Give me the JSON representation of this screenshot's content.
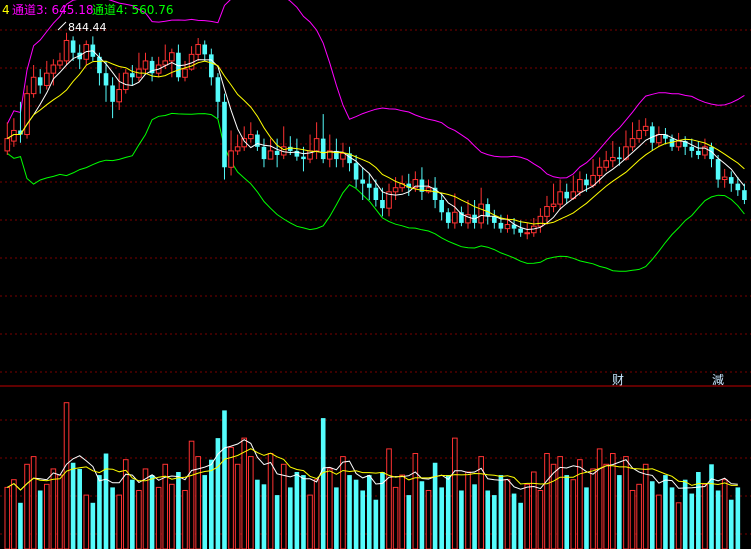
{
  "header": {
    "prefix": "4",
    "channel3_label": "通道3: 645.18",
    "channel4_label": "通道4: 560.76"
  },
  "annotations": {
    "high_label": "844.44",
    "marker_cai": "财",
    "marker_jian": "減"
  },
  "colors": {
    "up": "#ff3232",
    "down": "#54fcfc",
    "ma_white": "#ffffff",
    "ma_yellow": "#ffff00",
    "upper_band": "#ff00ff",
    "lower_band": "#00ff00",
    "grid": "#7a0000",
    "divider": "#c00000",
    "channel3_text": "#ff00ff",
    "channel4_text": "#00ff00",
    "marker_text": "#c8e8ff"
  },
  "chart_data": {
    "type": "candlestick+volume",
    "price_range": [
      420,
      860
    ],
    "volume_range": [
      0,
      100
    ],
    "candles": [
      [
        700,
        715,
        735,
        695
      ],
      [
        712,
        725,
        740,
        705
      ],
      [
        725,
        720,
        760,
        710
      ],
      [
        720,
        770,
        780,
        715
      ],
      [
        770,
        790,
        805,
        765
      ],
      [
        790,
        780,
        800,
        770
      ],
      [
        780,
        795,
        810,
        775
      ],
      [
        795,
        805,
        812,
        780
      ],
      [
        805,
        810,
        820,
        800
      ],
      [
        810,
        835,
        844.44,
        805
      ],
      [
        835,
        820,
        840,
        810
      ],
      [
        820,
        812,
        830,
        800
      ],
      [
        812,
        830,
        835,
        805
      ],
      [
        830,
        815,
        840,
        810
      ],
      [
        815,
        795,
        820,
        780
      ],
      [
        795,
        780,
        810,
        760
      ],
      [
        780,
        760,
        790,
        740
      ],
      [
        760,
        775,
        795,
        750
      ],
      [
        775,
        795,
        800,
        770
      ],
      [
        795,
        790,
        805,
        780
      ],
      [
        790,
        800,
        820,
        785
      ],
      [
        800,
        810,
        820,
        795
      ],
      [
        810,
        795,
        815,
        785
      ],
      [
        795,
        805,
        815,
        790
      ],
      [
        805,
        810,
        830,
        800
      ],
      [
        810,
        820,
        825,
        790
      ],
      [
        820,
        790,
        830,
        785
      ],
      [
        790,
        800,
        810,
        785
      ],
      [
        800,
        818,
        828,
        798
      ],
      [
        818,
        830,
        838,
        810
      ],
      [
        830,
        818,
        835,
        810
      ],
      [
        818,
        790,
        825,
        780
      ],
      [
        790,
        760,
        795,
        740
      ],
      [
        760,
        680,
        770,
        665
      ],
      [
        680,
        700,
        725,
        670
      ],
      [
        700,
        705,
        720,
        695
      ],
      [
        705,
        715,
        730,
        700
      ],
      [
        715,
        720,
        735,
        710
      ],
      [
        720,
        705,
        725,
        700
      ],
      [
        705,
        690,
        715,
        680
      ],
      [
        690,
        700,
        715,
        690
      ],
      [
        700,
        695,
        715,
        680
      ],
      [
        695,
        705,
        730,
        690
      ],
      [
        705,
        700,
        718,
        695
      ],
      [
        700,
        693,
        715,
        688
      ],
      [
        693,
        690,
        705,
        675
      ],
      [
        690,
        700,
        720,
        685
      ],
      [
        700,
        715,
        735,
        690
      ],
      [
        715,
        690,
        745,
        685
      ],
      [
        690,
        700,
        720,
        680
      ],
      [
        700,
        690,
        715,
        680
      ],
      [
        690,
        697,
        710,
        680
      ],
      [
        697,
        685,
        705,
        675
      ],
      [
        685,
        665,
        695,
        655
      ],
      [
        665,
        660,
        680,
        640
      ],
      [
        660,
        655,
        672,
        640
      ],
      [
        655,
        640,
        665,
        632
      ],
      [
        640,
        630,
        655,
        620
      ],
      [
        630,
        650,
        660,
        620
      ],
      [
        650,
        655,
        668,
        640
      ],
      [
        655,
        660,
        670,
        650
      ],
      [
        660,
        655,
        672,
        645
      ],
      [
        655,
        665,
        675,
        650
      ],
      [
        665,
        650,
        680,
        640
      ],
      [
        650,
        655,
        665,
        648
      ],
      [
        655,
        640,
        668,
        630
      ],
      [
        640,
        625,
        648,
        615
      ],
      [
        625,
        612,
        630,
        605
      ],
      [
        612,
        625,
        648,
        605
      ],
      [
        625,
        612,
        632,
        608
      ],
      [
        612,
        622,
        640,
        605
      ],
      [
        622,
        612,
        640,
        605
      ],
      [
        612,
        635,
        655,
        605
      ],
      [
        635,
        620,
        642,
        610
      ],
      [
        620,
        612,
        628,
        605
      ],
      [
        612,
        605,
        622,
        600
      ],
      [
        605,
        610,
        622,
        600
      ],
      [
        610,
        605,
        618,
        598
      ],
      [
        605,
        600,
        615,
        595
      ],
      [
        600,
        600,
        612,
        592
      ],
      [
        600,
        608,
        618,
        595
      ],
      [
        608,
        620,
        630,
        600
      ],
      [
        620,
        632,
        645,
        610
      ],
      [
        632,
        635,
        660,
        625
      ],
      [
        635,
        650,
        665,
        628
      ],
      [
        650,
        642,
        660,
        635
      ],
      [
        642,
        650,
        670,
        640
      ],
      [
        650,
        665,
        675,
        645
      ],
      [
        665,
        658,
        672,
        650
      ],
      [
        658,
        670,
        690,
        655
      ],
      [
        670,
        680,
        692,
        660
      ],
      [
        680,
        688,
        700,
        675
      ],
      [
        688,
        692,
        712,
        680
      ],
      [
        692,
        690,
        705,
        682
      ],
      [
        690,
        705,
        725,
        688
      ],
      [
        705,
        715,
        735,
        700
      ],
      [
        715,
        725,
        738,
        710
      ],
      [
        725,
        730,
        740,
        718
      ],
      [
        730,
        710,
        735,
        700
      ],
      [
        710,
        720,
        730,
        705
      ],
      [
        720,
        715,
        728,
        708
      ],
      [
        715,
        705,
        720,
        700
      ],
      [
        705,
        712,
        722,
        700
      ],
      [
        712,
        705,
        718,
        695
      ],
      [
        705,
        700,
        715,
        692
      ],
      [
        700,
        695,
        712,
        690
      ],
      [
        695,
        705,
        715,
        690
      ],
      [
        705,
        690,
        710,
        680
      ],
      [
        690,
        665,
        695,
        655
      ],
      [
        665,
        668,
        678,
        655
      ],
      [
        668,
        660,
        675,
        650
      ],
      [
        660,
        652,
        668,
        645
      ],
      [
        652,
        640,
        660,
        635
      ]
    ],
    "volumes": [
      40,
      45,
      30,
      55,
      60,
      38,
      42,
      52,
      48,
      95,
      56,
      52,
      35,
      30,
      48,
      62,
      40,
      35,
      58,
      45,
      38,
      52,
      48,
      40,
      55,
      42,
      50,
      38,
      70,
      60,
      48,
      58,
      72,
      90,
      66,
      55,
      72,
      60,
      45,
      42,
      62,
      35,
      55,
      40,
      50,
      48,
      35,
      45,
      85,
      52,
      40,
      60,
      48,
      45,
      38,
      48,
      32,
      50,
      65,
      40,
      48,
      35,
      62,
      44,
      38,
      56,
      40,
      48,
      72,
      38,
      50,
      42,
      60,
      38,
      35,
      48,
      45,
      36,
      30,
      42,
      50,
      38,
      62,
      55,
      60,
      48,
      45,
      58,
      40,
      52,
      65,
      55,
      62,
      48,
      60,
      38,
      42,
      55,
      44,
      35,
      48,
      40,
      30,
      45,
      36,
      50,
      42,
      55,
      38,
      45,
      32,
      40
    ]
  }
}
